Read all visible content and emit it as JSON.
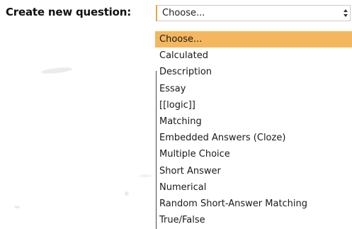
{
  "form": {
    "label": "Create new question:"
  },
  "select": {
    "current_value": "Choose...",
    "options": [
      "Choose...",
      "Calculated",
      "Description",
      "Essay",
      "[[logic]]",
      "Matching",
      "Embedded Answers (Cloze)",
      "Multiple Choice",
      "Short Answer",
      "Numerical",
      "Random Short-Answer Matching",
      "True/False"
    ],
    "highlighted_index": 0
  },
  "colors": {
    "highlight": "#f5b75e",
    "focus_border": "#e8a23c",
    "text": "#1a1a1a"
  },
  "icons": {
    "select_arrows": "chevron-up-down-icon"
  }
}
